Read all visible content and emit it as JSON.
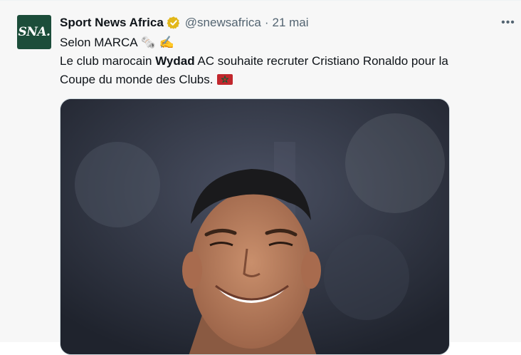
{
  "tweet": {
    "avatar_text": "SNA.",
    "display_name": "Sport News Africa",
    "handle": "@snewsafrica",
    "separator": "·",
    "date": "21 mai",
    "more_label": "•••",
    "line1": "Selon MARCA",
    "line1_emojis": "🗞️ ✍️",
    "line2_before": "Le club marocain ",
    "line2_bold": "Wydad",
    "line2_after": " AC souhaite recruter Cristiano Ronaldo pour la",
    "line3": "Coupe du monde des Clubs.",
    "flag_icon": "morocco-flag-icon",
    "verified_icon": "verified-badge-icon"
  },
  "colors": {
    "background": "#f7f7f7",
    "text": "#0f1419",
    "muted": "#536471",
    "verified_gold": "#e2b719",
    "avatar_bg": "#1c4d3a",
    "flag_red": "#c1272d",
    "flag_green": "#006233"
  }
}
